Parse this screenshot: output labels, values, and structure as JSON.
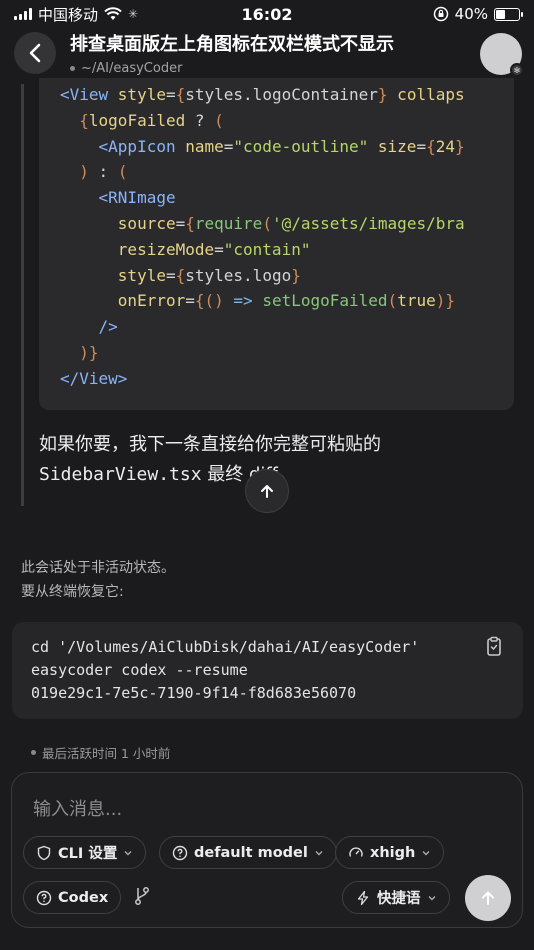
{
  "status_bar": {
    "carrier": "中国移动",
    "time": "16:02",
    "battery": "40%",
    "battery_level": 0.4
  },
  "header": {
    "title": "排查桌面版左上角图标在双栏模式不显示",
    "path": "~/AI/easyCoder"
  },
  "code_lines": [
    [
      {
        "c": "t-tag",
        "t": "<View "
      },
      {
        "c": "t-attr",
        "t": "style"
      },
      {
        "c": "t-plain",
        "t": "="
      },
      {
        "c": "t-brace",
        "t": "{"
      },
      {
        "c": "t-plain",
        "t": "styles.logoContainer"
      },
      {
        "c": "t-brace",
        "t": "}"
      },
      {
        "c": "t-attr",
        "t": " collaps"
      }
    ],
    [
      {
        "c": "t-plain",
        "t": "  "
      },
      {
        "c": "t-brace",
        "t": "{"
      },
      {
        "c": "t-attr",
        "t": "logoFailed"
      },
      {
        "c": "t-plain",
        "t": " ? "
      },
      {
        "c": "t-brace",
        "t": "("
      }
    ],
    [
      {
        "c": "t-plain",
        "t": "    "
      },
      {
        "c": "t-tag",
        "t": "<AppIcon "
      },
      {
        "c": "t-attr",
        "t": "name"
      },
      {
        "c": "t-plain",
        "t": "="
      },
      {
        "c": "t-str",
        "t": "\"code-outline\""
      },
      {
        "c": "t-attr",
        "t": " size"
      },
      {
        "c": "t-plain",
        "t": "="
      },
      {
        "c": "t-brace",
        "t": "{"
      },
      {
        "c": "t-attr",
        "t": "24"
      },
      {
        "c": "t-brace",
        "t": "}"
      }
    ],
    [
      {
        "c": "t-plain",
        "t": "  "
      },
      {
        "c": "t-brace",
        "t": ")"
      },
      {
        "c": "t-plain",
        "t": " : "
      },
      {
        "c": "t-brace",
        "t": "("
      }
    ],
    [
      {
        "c": "t-plain",
        "t": "    "
      },
      {
        "c": "t-tag",
        "t": "<RNImage"
      }
    ],
    [
      {
        "c": "t-plain",
        "t": "      "
      },
      {
        "c": "t-attr",
        "t": "source"
      },
      {
        "c": "t-plain",
        "t": "="
      },
      {
        "c": "t-brace",
        "t": "{"
      },
      {
        "c": "t-fn",
        "t": "require"
      },
      {
        "c": "t-brace",
        "t": "("
      },
      {
        "c": "t-str",
        "t": "'@/assets/images/bra"
      }
    ],
    [
      {
        "c": "t-plain",
        "t": "      "
      },
      {
        "c": "t-attr",
        "t": "resizeMode"
      },
      {
        "c": "t-plain",
        "t": "="
      },
      {
        "c": "t-str",
        "t": "\"contain\""
      }
    ],
    [
      {
        "c": "t-plain",
        "t": "      "
      },
      {
        "c": "t-attr",
        "t": "style"
      },
      {
        "c": "t-plain",
        "t": "="
      },
      {
        "c": "t-brace",
        "t": "{"
      },
      {
        "c": "t-plain",
        "t": "styles.logo"
      },
      {
        "c": "t-brace",
        "t": "}"
      }
    ],
    [
      {
        "c": "t-plain",
        "t": "      "
      },
      {
        "c": "t-attr",
        "t": "onError"
      },
      {
        "c": "t-plain",
        "t": "="
      },
      {
        "c": "t-brace",
        "t": "{()"
      },
      {
        "c": "t-op",
        "t": " => "
      },
      {
        "c": "t-fn",
        "t": "setLogoFailed"
      },
      {
        "c": "t-brace",
        "t": "("
      },
      {
        "c": "t-attr",
        "t": "true"
      },
      {
        "c": "t-brace",
        "t": ")}"
      }
    ],
    [
      {
        "c": "t-plain",
        "t": "    "
      },
      {
        "c": "t-tag",
        "t": "/>"
      }
    ],
    [
      {
        "c": "t-plain",
        "t": "  "
      },
      {
        "c": "t-brace",
        "t": ")}"
      }
    ],
    [
      {
        "c": "t-tag",
        "t": "</View>"
      }
    ]
  ],
  "reply": {
    "line1": "如果你要，我下一条直接给你完整可粘贴的",
    "line2_code": "SidebarView.tsx",
    "line2_text": " 最终 diff。"
  },
  "inactive": {
    "line1": "此会话处于非活动状态。",
    "line2": "要从终端恢复它:"
  },
  "command": {
    "line1": "cd '/Volumes/AiClubDisk/dahai/AI/easyCoder'",
    "line2": "easycoder codex --resume",
    "line3": "019e29c1-7e5c-7190-9f14-f8d683e56070"
  },
  "last_active": "最后活跃时间 1 小时前",
  "composer": {
    "placeholder": "输入消息...",
    "cli_settings": "CLI 设置",
    "model": "default model",
    "effort": "xhigh",
    "agent": "Codex",
    "shortcuts": "快捷语"
  },
  "colors": {
    "background": "#1b1b1d",
    "code_background": "#2a2a2d",
    "accent_tag": "#8ab4f8",
    "accent_string": "#b5d66a",
    "send_button": "#d0d0d2"
  }
}
